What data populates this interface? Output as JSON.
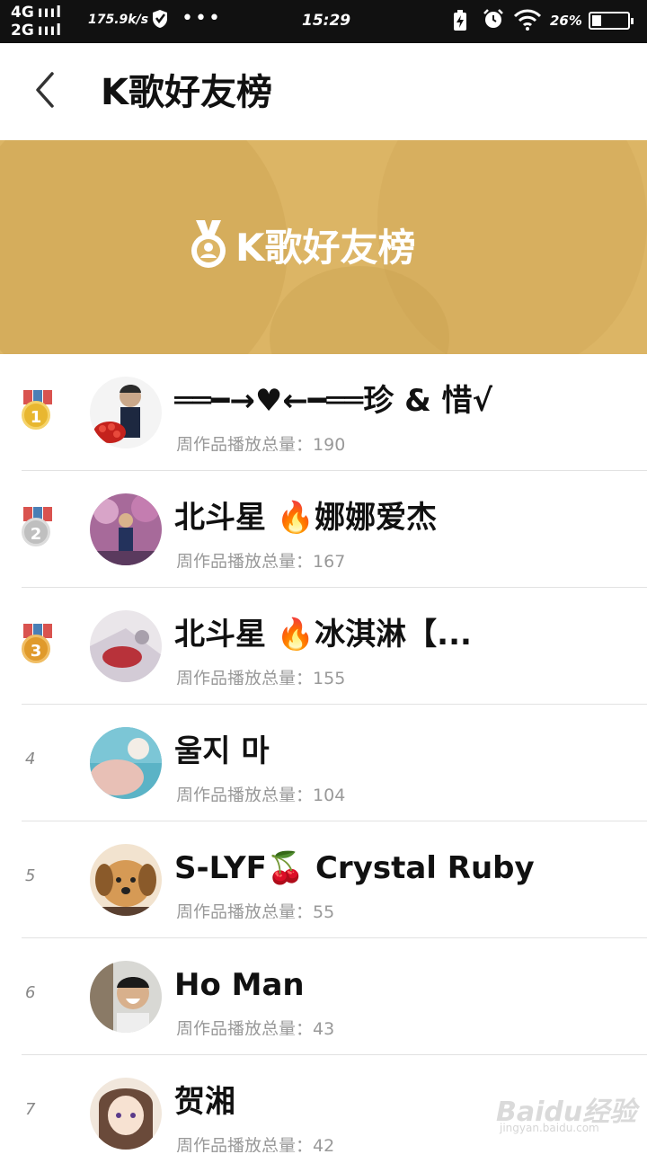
{
  "status_bar": {
    "network_1": "4G",
    "network_2": "2G",
    "signal_bars": "ıııl",
    "speed": "175.9k/s",
    "time": "15:29",
    "battery_pct": "26%",
    "battery_level": 0.26
  },
  "header": {
    "back_icon": "chevron-left-icon",
    "title": "K歌好友榜"
  },
  "banner": {
    "title": "K歌好友榜",
    "background_color": "#dcb565",
    "icon": "medal-icon"
  },
  "colors": {
    "gold": "#e8b730",
    "silver": "#bfbfbf",
    "bronze": "#e09a2b"
  },
  "list": [
    {
      "rank": "1",
      "medal": "gold",
      "name": "══━→♥←━══珍 & 惜√",
      "plays_label": "周作品播放总量：",
      "plays": "190"
    },
    {
      "rank": "2",
      "medal": "silver",
      "name": "北斗星 🔥娜娜爱杰",
      "plays_label": "周作品播放总量：",
      "plays": "167"
    },
    {
      "rank": "3",
      "medal": "bronze",
      "name": "北斗星 🔥冰淇淋【...",
      "plays_label": "周作品播放总量：",
      "plays": "155"
    },
    {
      "rank": "4",
      "medal": "",
      "name": "울지 마",
      "plays_label": "周作品播放总量：",
      "plays": "104"
    },
    {
      "rank": "5",
      "medal": "",
      "name": "S-LYF🍒 Crystal Ruby",
      "plays_label": "周作品播放总量：",
      "plays": "55"
    },
    {
      "rank": "6",
      "medal": "",
      "name": "Ho Man",
      "plays_label": "周作品播放总量：",
      "plays": "43"
    },
    {
      "rank": "7",
      "medal": "",
      "name": "贺湘",
      "plays_label": "周作品播放总量：",
      "plays": "42"
    }
  ],
  "watermark": {
    "text": "Baidu经验",
    "sub": "jingyan.baidu.com"
  }
}
